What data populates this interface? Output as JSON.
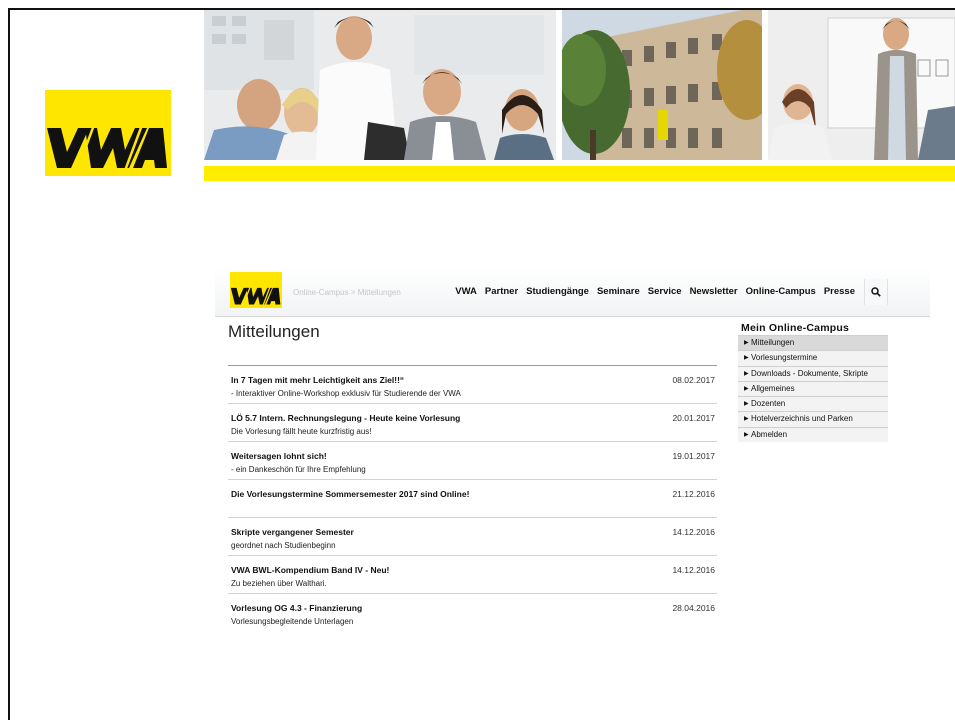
{
  "logo": {
    "text": "VWA"
  },
  "nav": {
    "breadcrumb": "Online-Campus > Mitteilungen",
    "items": [
      "VWA",
      "Partner",
      "Studiengänge",
      "Seminare",
      "Service",
      "Newsletter",
      "Online-Campus",
      "Presse"
    ],
    "search_icon": "search-icon"
  },
  "page": {
    "title": "Mitteilungen"
  },
  "messages": [
    {
      "title": "In 7 Tagen mit mehr Leichtigkeit ans Ziel!!“",
      "subtitle": "- Interaktiver Online-Workshop exklusiv für Studierende der VWA",
      "date": "08.02.2017"
    },
    {
      "title": "LÖ 5.7 Intern. Rechnungslegung - Heute keine Vorlesung",
      "subtitle": "Die Vorlesung fällt heute kurzfristig aus!",
      "date": "20.01.2017"
    },
    {
      "title": "Weitersagen lohnt sich!",
      "subtitle": "- ein Dankeschön für Ihre Empfehlung",
      "date": "19.01.2017"
    },
    {
      "title": "Die Vorlesungstermine Sommersemester 2017 sind Online!",
      "subtitle": "",
      "date": "21.12.2016"
    },
    {
      "title": "Skripte vergangener Semester",
      "subtitle": "geordnet nach Studienbeginn",
      "date": "14.12.2016"
    },
    {
      "title": "VWA BWL-Kompendium Band IV - Neu!",
      "subtitle": "Zu beziehen über Walthari.",
      "date": "14.12.2016"
    },
    {
      "title": "Vorlesung OG 4.3 - Finanzierung",
      "subtitle": "Vorlesungsbegleitende Unterlagen",
      "date": "28.04.2016"
    }
  ],
  "sidebar": {
    "title": "Mein Online-Campus",
    "items": [
      "Mitteilungen",
      "Vorlesungstermine",
      "Downloads - Dokumente, Skripte",
      "Allgemeines",
      "Dozenten",
      "Hotelverzeichnis und Parken",
      "Abmelden"
    ],
    "active_index": 0
  },
  "colors": {
    "brand_yellow": "#ffe600",
    "text": "#222222"
  }
}
